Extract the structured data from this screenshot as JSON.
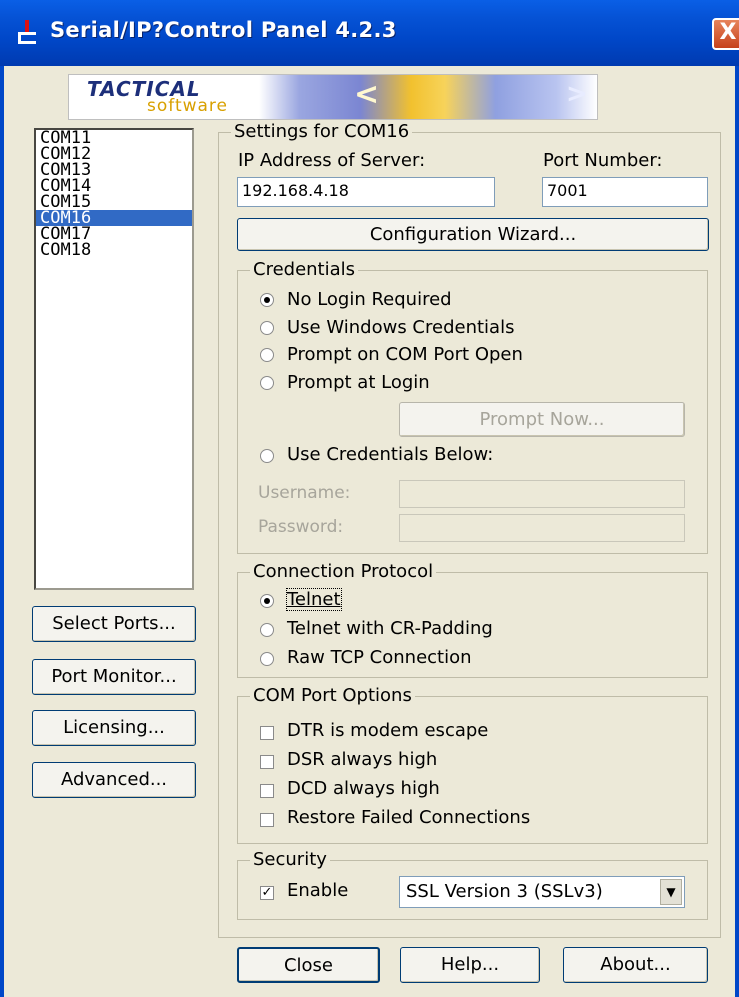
{
  "window": {
    "title": "Serial/IP?Control Panel 4.2.3",
    "close_glyph": "X"
  },
  "logo": {
    "tactical": "TACTICAL",
    "software": "software"
  },
  "ports": [
    "COM11",
    "COM12",
    "COM13",
    "COM14",
    "COM15",
    "COM16",
    "COM17",
    "COM18"
  ],
  "selected_port": "COM16",
  "left_buttons": {
    "select_ports": "Select Ports...",
    "port_monitor": "Port Monitor...",
    "licensing": "Licensing...",
    "advanced": "Advanced..."
  },
  "settings": {
    "group_title": "Settings for COM16",
    "ip_label": "IP Address of Server:",
    "ip_value": "192.168.4.18",
    "port_label": "Port Number:",
    "port_value": "7001",
    "wizard_button": "Configuration Wizard..."
  },
  "credentials": {
    "title": "Credentials",
    "options": [
      "No Login Required",
      "Use Windows Credentials",
      "Prompt on COM Port Open",
      "Prompt at Login"
    ],
    "selected": "No Login Required",
    "prompt_now": "Prompt Now...",
    "use_below": "Use Credentials Below:",
    "username_label": "Username:",
    "password_label": "Password:"
  },
  "protocol": {
    "title": "Connection Protocol",
    "telnet": "Telnet",
    "telnet_cr": "Telnet with CR-Padding",
    "raw_tcp": "Raw TCP Connection",
    "selected": "Telnet"
  },
  "com_options": {
    "title": "COM Port Options",
    "dtr": "DTR is modem escape",
    "dsr": "DSR always high",
    "dcd": "DCD always high",
    "restore": "Restore Failed Connections"
  },
  "security": {
    "title": "Security",
    "enable": "Enable",
    "enabled": true,
    "ssl_value": "SSL Version 3 (SSLv3)"
  },
  "bottom_buttons": {
    "close": "Close",
    "help": "Help...",
    "about": "About..."
  }
}
